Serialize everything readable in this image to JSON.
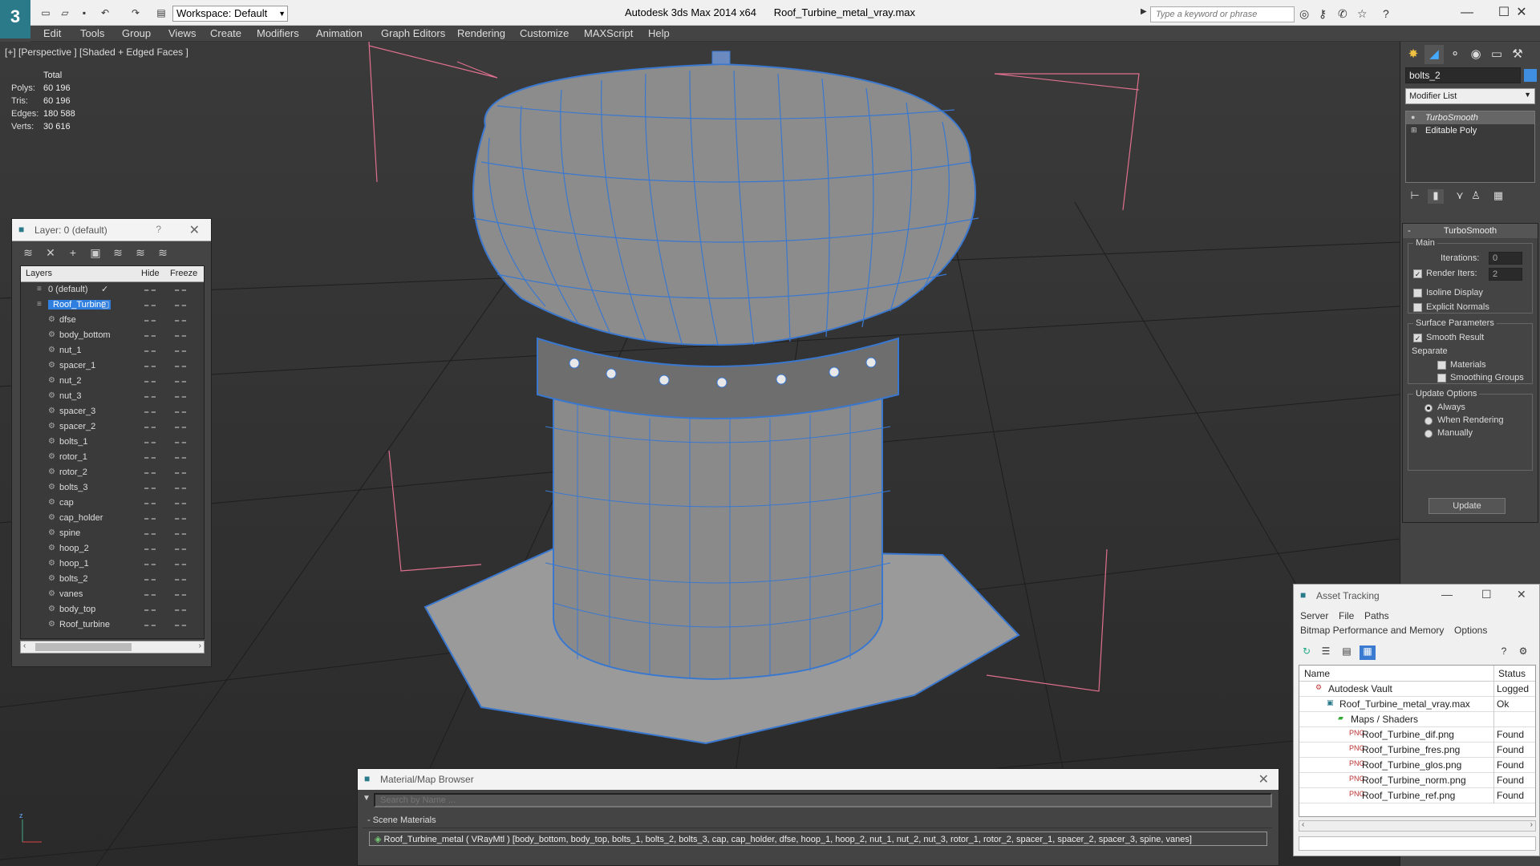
{
  "titlebar": {
    "workspace": "Workspace: Default",
    "app_title": "Autodesk 3ds Max  2014 x64",
    "file_name": "Roof_Turbine_metal_vray.max",
    "search_placeholder": "Type a keyword or phrase"
  },
  "menu": [
    "Edit",
    "Tools",
    "Group",
    "Views",
    "Create",
    "Modifiers",
    "Animation",
    "Graph Editors",
    "Rendering",
    "Customize",
    "MAXScript",
    "Help"
  ],
  "viewport": {
    "label": "[+] [Perspective ] [Shaded + Edged Faces ]",
    "stats": {
      "header": "Total",
      "polys_label": "Polys:",
      "polys": "60 196",
      "tris_label": "Tris:",
      "tris": "60 196",
      "edges_label": "Edges:",
      "edges": "180 588",
      "verts_label": "Verts:",
      "verts": "30 616"
    }
  },
  "layer_panel": {
    "title": "Layer: 0 (default)",
    "help": "?",
    "col_layers": "Layers",
    "col_hide": "Hide",
    "col_freeze": "Freeze",
    "layers": [
      "0 (default)",
      "Roof_Turbine"
    ],
    "objects": [
      "dfse",
      "body_bottom",
      "nut_1",
      "spacer_1",
      "nut_2",
      "nut_3",
      "spacer_3",
      "spacer_2",
      "bolts_1",
      "rotor_1",
      "rotor_2",
      "bolts_3",
      "cap",
      "cap_holder",
      "spine",
      "hoop_2",
      "hoop_1",
      "bolts_2",
      "vanes",
      "body_top",
      "Roof_turbine"
    ]
  },
  "material_browser": {
    "title": "Material/Map Browser",
    "search_placeholder": "Search by Name ...",
    "section": "- Scene Materials",
    "material": "Roof_Turbine_metal  ( VRayMtl ) [body_bottom, body_top, bolts_1, bolts_2, bolts_3, cap, cap_holder, dfse, hoop_1, hoop_2, nut_1, nut_2, nut_3, rotor_1, rotor_2, spacer_1, spacer_2, spacer_3, spine, vanes]"
  },
  "command_panel": {
    "object_name": "bolts_2",
    "object_color": "#3f8ee0",
    "modifier_list": "Modifier List",
    "stack": [
      "TurboSmooth",
      "Editable Poly"
    ],
    "rollout_title": "TurboSmooth",
    "main_group": "Main",
    "iterations_label": "Iterations:",
    "iterations": "0",
    "render_iters_label": "Render Iters:",
    "render_iters": "2",
    "isoline": "Isoline Display",
    "explicit_normals": "Explicit Normals",
    "surface_group": "Surface Parameters",
    "smooth_result": "Smooth Result",
    "separate": "Separate",
    "materials": "Materials",
    "smoothing_groups": "Smoothing Groups",
    "update_group": "Update Options",
    "always": "Always",
    "when_rendering": "When Rendering",
    "manually": "Manually",
    "update_button": "Update"
  },
  "asset_tracking": {
    "title": "Asset Tracking",
    "menu1": [
      "Server",
      "File",
      "Paths"
    ],
    "menu2": [
      "Bitmap Performance and Memory",
      "Options"
    ],
    "col_name": "Name",
    "col_status": "Status",
    "rows": [
      {
        "name": "Autodesk Vault",
        "status": "Logged"
      },
      {
        "name": "Roof_Turbine_metal_vray.max",
        "status": "Ok"
      },
      {
        "name": "Maps / Shaders",
        "status": ""
      },
      {
        "name": "Roof_Turbine_dif.png",
        "status": "Found"
      },
      {
        "name": "Roof_Turbine_fres.png",
        "status": "Found"
      },
      {
        "name": "Roof_Turbine_glos.png",
        "status": "Found"
      },
      {
        "name": "Roof_Turbine_norm.png",
        "status": "Found"
      },
      {
        "name": "Roof_Turbine_ref.png",
        "status": "Found"
      }
    ]
  }
}
